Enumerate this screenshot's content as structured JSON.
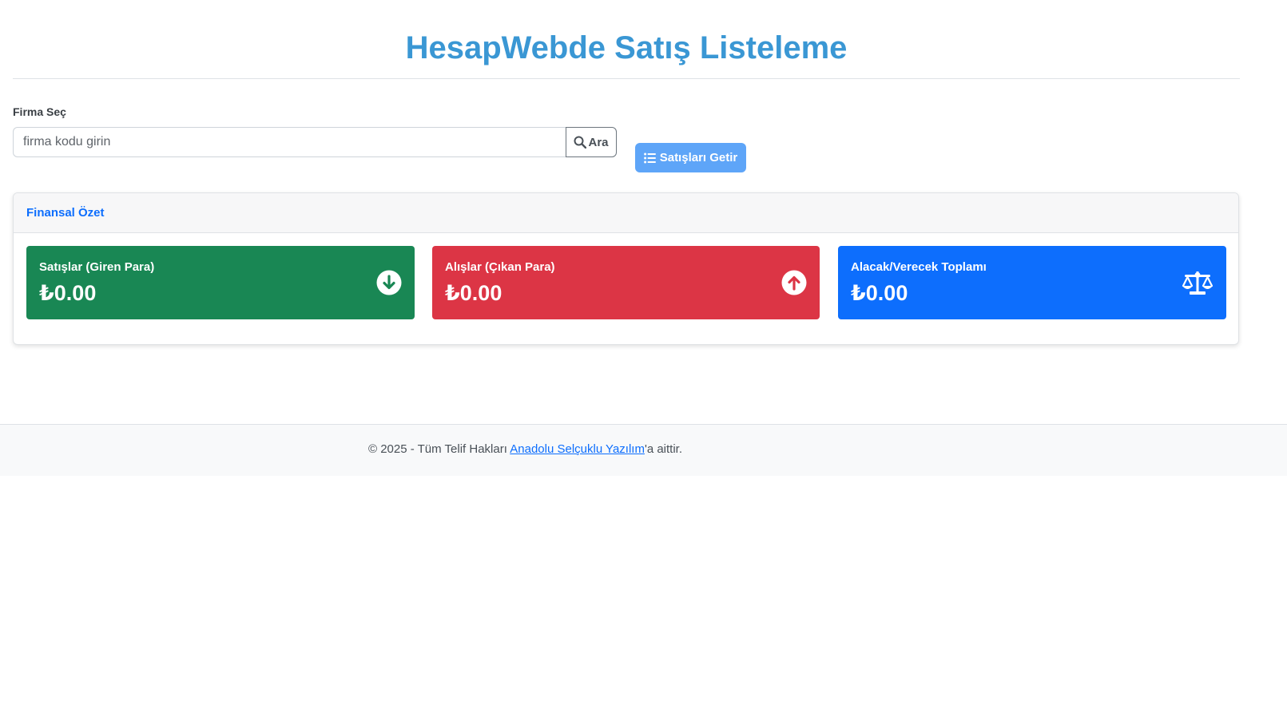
{
  "header": {
    "title": "HesapWebde Satış Listeleme"
  },
  "firm_select": {
    "label": "Firma Seç",
    "input_value": "",
    "input_placeholder": "firma kodu girin",
    "search_button": "Ara",
    "search_icon": "magnifier-icon"
  },
  "fetch_button": {
    "label": "Satışları Getir",
    "icon": "list-icon"
  },
  "summary": {
    "title": "Finansal Özet",
    "cards": [
      {
        "label": "Satışlar (Giren Para)",
        "value": "₺0.00",
        "icon": "arrow-down-circle-icon",
        "color": "#198754"
      },
      {
        "label": "Alışlar (Çıkan Para)",
        "value": "₺0.00",
        "icon": "arrow-up-circle-icon",
        "color": "#dc3545"
      },
      {
        "label": "Alacak/Verecek Toplamı",
        "value": "₺0.00",
        "icon": "scale-balance-icon",
        "color": "#0d6efd"
      }
    ]
  },
  "footer": {
    "prefix": "© 2025 - Tüm Telif Hakları ",
    "link_text": "Anadolu Selçuklu Yazılım",
    "suffix": "'a aittir."
  },
  "colors": {
    "title": "#3a97d4",
    "primary": "#0d6efd",
    "fetch_button_bg": "#5ea5f8"
  }
}
